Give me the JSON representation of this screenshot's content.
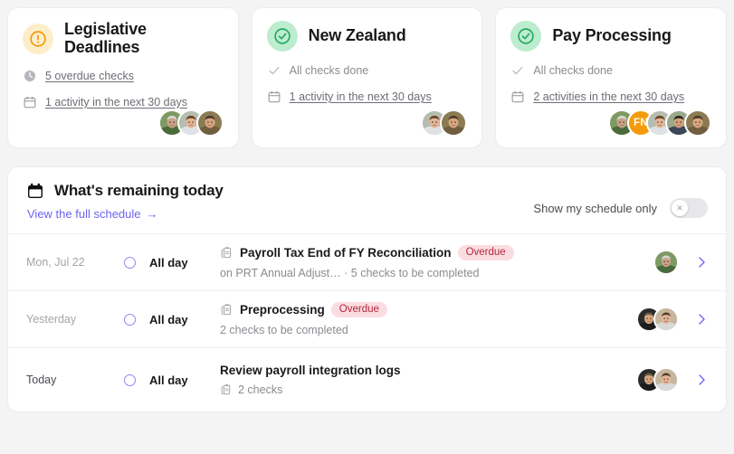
{
  "colors": {
    "page_bg": "#f4f4f5",
    "card_bg": "#ffffff",
    "warn_badge_bg": "#fdeec9",
    "warn_icon": "#f0990f",
    "ok_badge_bg": "#bdeccf",
    "ok_icon": "#24a862",
    "accent_purple": "#6c63f1",
    "overdue_text": "#b1283c",
    "overdue_bg": "#fbdde1",
    "initials_avatar_bg": "#f59b0b"
  },
  "cards": [
    {
      "icon": "circle-exclamation-icon",
      "icon_style": "warn",
      "title": "Legislative Deadlines",
      "rows": [
        {
          "icon": "clock-icon",
          "text": "5 overdue checks",
          "link": true,
          "muted": false
        },
        {
          "icon": "calendar-icon",
          "text": "1 activity in the next 30 days",
          "link": true,
          "muted": false
        }
      ],
      "avatars": [
        {
          "type": "photo",
          "skin": "#c9a389",
          "hair": "#d8d8d4",
          "bg": "#7d9a63",
          "shirt": "#4c6b3c"
        },
        {
          "type": "photo",
          "skin": "#e2b598",
          "hair": "#6b4329",
          "bg": "#b6bdb0",
          "shirt": "#dfe2e4"
        },
        {
          "type": "photo",
          "skin": "#d8a77f",
          "hair": "#4a3a2c",
          "bg": "#8c7b52",
          "shirt": "#6f5f3f"
        }
      ]
    },
    {
      "icon": "circle-check-icon",
      "icon_style": "ok",
      "title": "New Zealand",
      "rows": [
        {
          "icon": "check-icon",
          "text": "All checks done",
          "link": false,
          "muted": true
        },
        {
          "icon": "calendar-icon",
          "text": "1 activity in the next 30 days",
          "link": true,
          "muted": false
        }
      ],
      "avatars": [
        {
          "type": "photo",
          "skin": "#e2b598",
          "hair": "#6b4329",
          "bg": "#b6bdb0",
          "shirt": "#dfe2e4"
        },
        {
          "type": "photo",
          "skin": "#d8a77f",
          "hair": "#4a3a2c",
          "bg": "#8c7b52",
          "shirt": "#6f5f3f"
        }
      ]
    },
    {
      "icon": "circle-check-icon",
      "icon_style": "ok",
      "title": "Pay Processing",
      "rows": [
        {
          "icon": "check-icon",
          "text": "All checks done",
          "link": false,
          "muted": true
        },
        {
          "icon": "calendar-icon",
          "text": "2 activities in the next 30 days",
          "link": true,
          "muted": false
        }
      ],
      "avatars": [
        {
          "type": "photo",
          "skin": "#c9a389",
          "hair": "#d8d8d4",
          "bg": "#7d9a63",
          "shirt": "#4c6b3c"
        },
        {
          "type": "initials",
          "initials": "FN"
        },
        {
          "type": "photo",
          "skin": "#e2b598",
          "hair": "#6b4329",
          "bg": "#b6bdb0",
          "shirt": "#dfe2e4"
        },
        {
          "type": "photo",
          "skin": "#d2a07c",
          "hair": "#2e2620",
          "bg": "#9aa98b",
          "shirt": "#3b4657"
        },
        {
          "type": "photo",
          "skin": "#d8a77f",
          "hair": "#4a3a2c",
          "bg": "#8c7b52",
          "shirt": "#6f5f3f"
        }
      ]
    }
  ],
  "schedule": {
    "icon": "calendar-icon",
    "title": "What's remaining today",
    "link_label": "View the full schedule",
    "link_arrow": "→",
    "toggle_label": "Show my schedule only",
    "toggle_on": false,
    "toggle_knob_glyph": "✕",
    "rows": [
      {
        "date": "Mon, Jul 22",
        "is_today": false,
        "all_day": "All day",
        "has_task_icon": true,
        "title": "Payroll Tax End of FY Reconciliation",
        "badge": "Overdue",
        "sub_icon": "",
        "subtitle": "on PRT Annual Adjust…   · 5 checks to be completed",
        "avatars": [
          {
            "type": "photo",
            "skin": "#c9a389",
            "hair": "#d8d8d4",
            "bg": "#7d9a63",
            "shirt": "#4c6b3c"
          }
        ]
      },
      {
        "date": "Yesterday",
        "is_today": false,
        "all_day": "All day",
        "has_task_icon": true,
        "title": "Preprocessing",
        "badge": "Overdue",
        "sub_icon": "",
        "subtitle": "2 checks to be completed",
        "avatars": [
          {
            "type": "photo",
            "skin": "#d9a77f",
            "hair": "#6d5a42",
            "bg": "#2b2b2b",
            "shirt": "#1d1d1d"
          },
          {
            "type": "photo",
            "skin": "#e2b598",
            "hair": "#5a3a26",
            "bg": "#c4b79e",
            "shirt": "#d9d9d9"
          }
        ]
      },
      {
        "date": "Today",
        "is_today": true,
        "all_day": "All day",
        "has_task_icon": false,
        "title": "Review payroll integration logs",
        "badge": "",
        "sub_icon": "clipboard-icon",
        "subtitle": "2 checks",
        "avatars": [
          {
            "type": "photo",
            "skin": "#d9a77f",
            "hair": "#6d5a42",
            "bg": "#2b2b2b",
            "shirt": "#1d1d1d"
          },
          {
            "type": "photo",
            "skin": "#e2b598",
            "hair": "#5a3a26",
            "bg": "#c4b79e",
            "shirt": "#d9d9d9"
          }
        ]
      }
    ]
  }
}
